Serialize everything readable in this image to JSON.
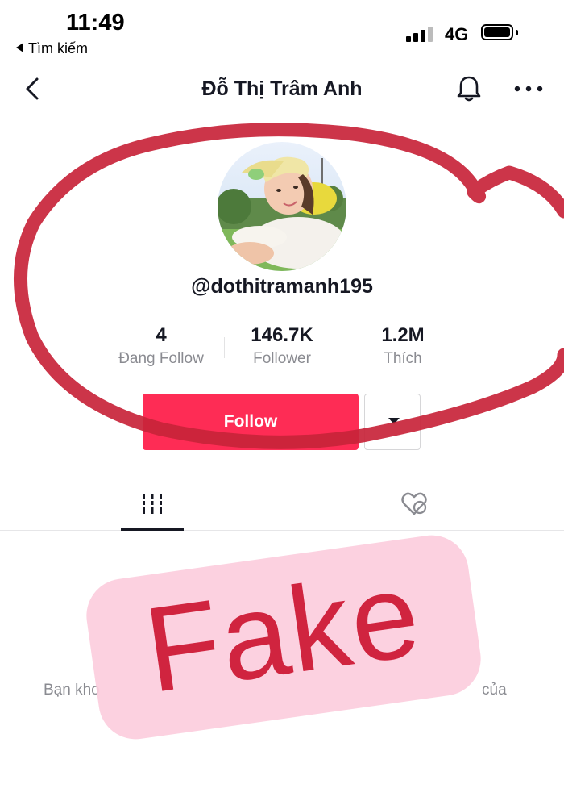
{
  "status_bar": {
    "time": "11:49",
    "back_label": "Tìm kiếm",
    "network": "4G"
  },
  "nav": {
    "title": "Đỗ Thị Trâm Anh",
    "back_icon": "chevron-left-icon",
    "bell_icon": "bell-icon",
    "more_icon": "more-horizontal-icon"
  },
  "profile": {
    "username": "@dothitramanh195",
    "stats": [
      {
        "value": "4",
        "label": "Đang Follow"
      },
      {
        "value": "146.7K",
        "label": "Follower"
      },
      {
        "value": "1.2M",
        "label": "Thích"
      }
    ],
    "follow_label": "Follow"
  },
  "tabs": {
    "videos_icon": "grid-icon",
    "liked_icon": "hidden-heart-icon"
  },
  "content": {
    "empty_left": "Bạn kho",
    "empty_right": "của"
  },
  "overlay": {
    "stamp_text": "Fake",
    "stamp_color": "#d0243f",
    "ring_color": "#c8243a"
  },
  "colors": {
    "accent": "#fe2c55",
    "text_primary": "#161823",
    "text_secondary": "#8a8b91"
  }
}
